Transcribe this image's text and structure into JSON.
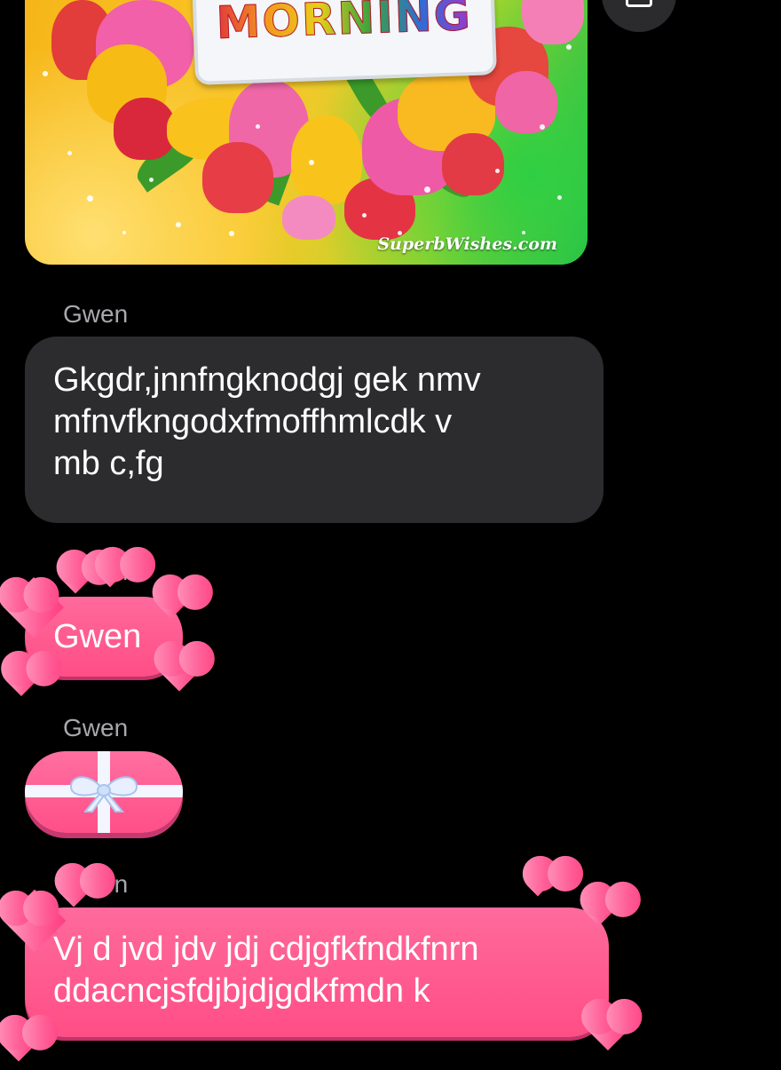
{
  "image_attachment": {
    "banner_text": "MORNING",
    "watermark": "SuperbWishes.com"
  },
  "messages": [
    {
      "sender": "Gwen",
      "style": "default",
      "text": "Gkgdr,jnnfngknodgj gek nmv\nmfnvfkngodxfmoffhmlcdk v\nmb c,fg"
    },
    {
      "sender": "Gwen",
      "style": "love-hearts",
      "text": "Gwen"
    },
    {
      "sender": "Gwen",
      "style": "gift",
      "text": ""
    },
    {
      "sender": "Gwen",
      "style": "love-hearts",
      "text": "Vj d jvd jdv jdj cdjgfkfndkfnrn\nddacncjsfdjbjdjgdkfmdn k"
    }
  ],
  "colors": {
    "background": "#000000",
    "bubble_gray": "#2c2c2e",
    "bubble_pink": "#ff5a8f",
    "sender_label": "#a8a8ad"
  },
  "icons": {
    "corner_button": "share-icon",
    "gift": "gift-bow-icon",
    "hearts": "heart-icon"
  }
}
